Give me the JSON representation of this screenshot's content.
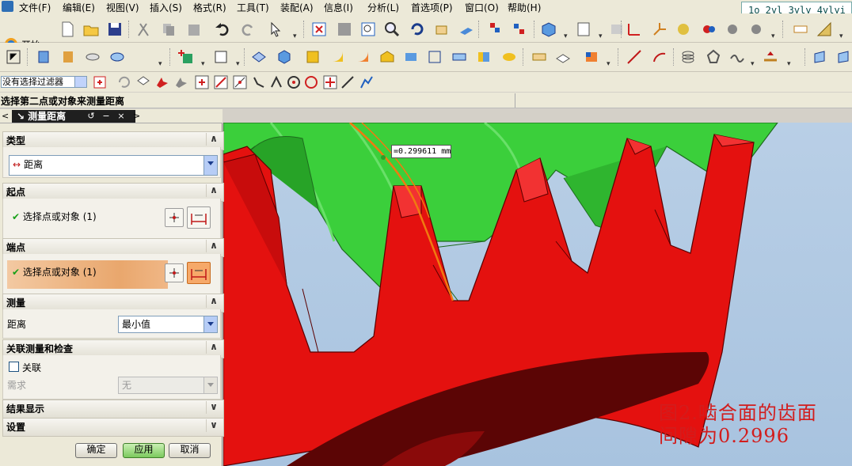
{
  "menu": {
    "items": [
      "文件(F)",
      "编辑(E)",
      "视图(V)",
      "插入(S)",
      "格式(R)",
      "工具(T)",
      "装配(A)",
      "信息(I)",
      "分析(L)",
      "首选项(P)",
      "窗口(O)",
      "帮助(H)"
    ]
  },
  "command_line": "1o 2yl 3yly 4ylyi",
  "toolbar": {
    "start_label": "开始"
  },
  "filter": {
    "selected": "没有选择过滤器"
  },
  "status": {
    "prompt": "选择第二点或对象来测量距离"
  },
  "dialog": {
    "title": "测量距离",
    "sections": {
      "type": {
        "header": "类型",
        "value": "距离"
      },
      "start": {
        "header": "起点",
        "row": "选择点或对象 (1)"
      },
      "end": {
        "header": "端点",
        "row": "选择点或对象 (1)"
      },
      "measure": {
        "header": "测量",
        "label": "距离",
        "value": "最小值"
      },
      "assoc": {
        "header": "关联测量和检查",
        "checkbox": "关联",
        "req_label": "需求",
        "req_value": "无"
      },
      "results": {
        "header": "结果显示"
      },
      "settings": {
        "header": "设置"
      }
    },
    "buttons": {
      "ok": "确定",
      "apply": "应用",
      "cancel": "取消"
    }
  },
  "viewport": {
    "annotation": "=0.299611 mm",
    "caption_line1": "图2.啮合面的齿面",
    "caption_line2": "间隙为0.2996",
    "colors": {
      "gear_red": "#e4110f",
      "gear_green": "#3bcf3b",
      "background": "#b9cfe6",
      "caption": "#d21d1d"
    }
  }
}
